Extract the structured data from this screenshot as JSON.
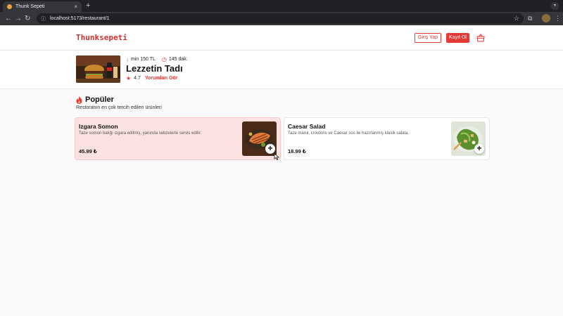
{
  "browser": {
    "tab_title": "Thunk Sepeti",
    "url": "localhost:5173/restaurant/1",
    "new_tab": "+",
    "tab_close": "×"
  },
  "header": {
    "logo": "Thunksepeti",
    "login_label": "Giriş Yap",
    "signup_label": "Kayıt Ol"
  },
  "restaurant": {
    "min_order": "min 150 TL",
    "delivery_time": "145 dak.",
    "name": "Lezzetin Tadı",
    "rating": "4.7",
    "reviews_link": "Yorumları Gör"
  },
  "popular": {
    "title": "Popüler",
    "subtitle": "Restoranın en çok tercih edilen ürünleri",
    "items": [
      {
        "name": "Izgara Somon",
        "description": "Taze somon balığı ızgara edilmiş, yanında sebzelerle servis edilir.",
        "price": "45.99 ₺"
      },
      {
        "name": "Caesar Salad",
        "description": "Taze marul, croutons ve Caesar sos ile hazırlanmış klasik salata.",
        "price": "18.99 ₺"
      }
    ]
  },
  "colors": {
    "accent": "#e53935",
    "card_hover": "#fde2e2"
  }
}
